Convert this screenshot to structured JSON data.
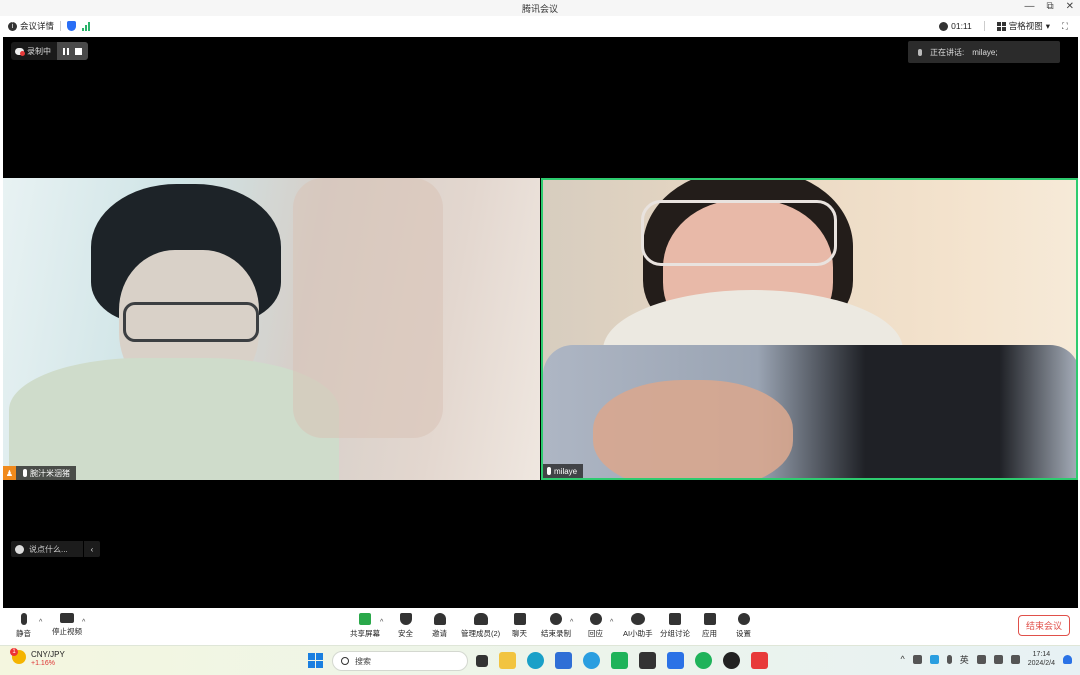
{
  "window": {
    "title": "腾讯会议",
    "min": "—",
    "restore": "⧉",
    "close": "✕"
  },
  "infobar": {
    "details": "会议详情",
    "timer": "01:11",
    "view": "宫格视图",
    "view_caret": "▾",
    "fullscreen": "⛶"
  },
  "recording": {
    "label": "录制中"
  },
  "speaking": {
    "label": "正在讲话:",
    "name": "milaye;"
  },
  "participants": [
    {
      "name": "腕汁米洇猪",
      "host": true
    },
    {
      "name": "milaye",
      "host": false,
      "active_speaker": true
    }
  ],
  "chat": {
    "placeholder": "说点什么...",
    "collapse": "‹"
  },
  "toolbar": {
    "mute": "静音",
    "stop_video": "停止视频",
    "share": "共享屏幕",
    "security": "安全",
    "invite": "邀请",
    "manage_members": "管理成员(2)",
    "chat": "聊天",
    "end_recording": "结束录制",
    "reactions": "回应",
    "ai_assistant": "AI小助手",
    "breakout": "分组讨论",
    "apps": "应用",
    "settings": "设置",
    "end_meeting": "结束会议",
    "caret": "^"
  },
  "taskbar": {
    "ticker_symbol": "CNY/JPY",
    "ticker_change": "+1.16%",
    "badge": "1",
    "search": "搜索",
    "tray_caret": "^",
    "ime": "英",
    "time": "17:14",
    "date": "2024/2/4"
  },
  "colors": {
    "active_border": "#2ecb6f",
    "end_button": "#e0504a",
    "host_badge": "#f08a1c"
  }
}
